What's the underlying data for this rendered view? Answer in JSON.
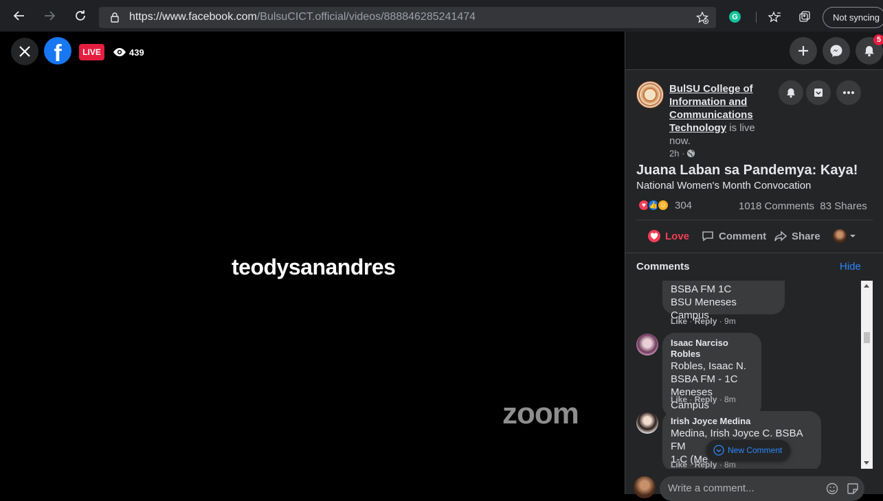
{
  "browser": {
    "url_main": "https://www.facebook.com",
    "url_path": "/BulsuCICT.official/videos/888846285241474",
    "grammarly": "G",
    "sync_label": "Not syncing"
  },
  "video": {
    "live_label": "LIVE",
    "viewer_count": "439",
    "speaker_name": "teodysanandres",
    "watermark": "zoom"
  },
  "panel": {
    "notification_count": "5",
    "post": {
      "page_name": "BulSU College of Information and Communications Technology",
      "live_text": "is live now.",
      "time": "2h ·",
      "title": "Juana Laban sa Pandemya: Kaya!",
      "subtitle": "National Women's Month Convocation",
      "reaction_count": "304",
      "comments_count": "1018 Comments",
      "shares_count": "83 Shares"
    },
    "actions": {
      "love": "Love",
      "comment": "Comment",
      "share": "Share"
    },
    "comments_header": {
      "title": "Comments",
      "hide": "Hide"
    },
    "comments": [
      {
        "author": "",
        "lines": [
          "BSBA FM 1C",
          "BSU Meneses Campus"
        ],
        "like": "Like",
        "reply": "Reply",
        "time": "· 9m"
      },
      {
        "author": "Isaac Narciso Robles",
        "lines": [
          "Robles, Isaac N.",
          "BSBA FM - 1C",
          "Meneses Campus"
        ],
        "like": "Like",
        "reply": "Reply",
        "time": "· 8m"
      },
      {
        "author": "Irish Joyce Medina",
        "lines": [
          "Medina, Irish Joyce C. BSBA FM",
          "1-C (Me"
        ],
        "like": "Like",
        "reply": "Reply",
        "time": "· 8m"
      }
    ],
    "new_comment_label": "New Comment",
    "write_placeholder": "Write a comment..."
  },
  "colors": {
    "live_red": "#e41e3f",
    "facebook_blue": "#1877f2",
    "love_pink": "#f33e58",
    "link_blue": "#2d88ff"
  }
}
